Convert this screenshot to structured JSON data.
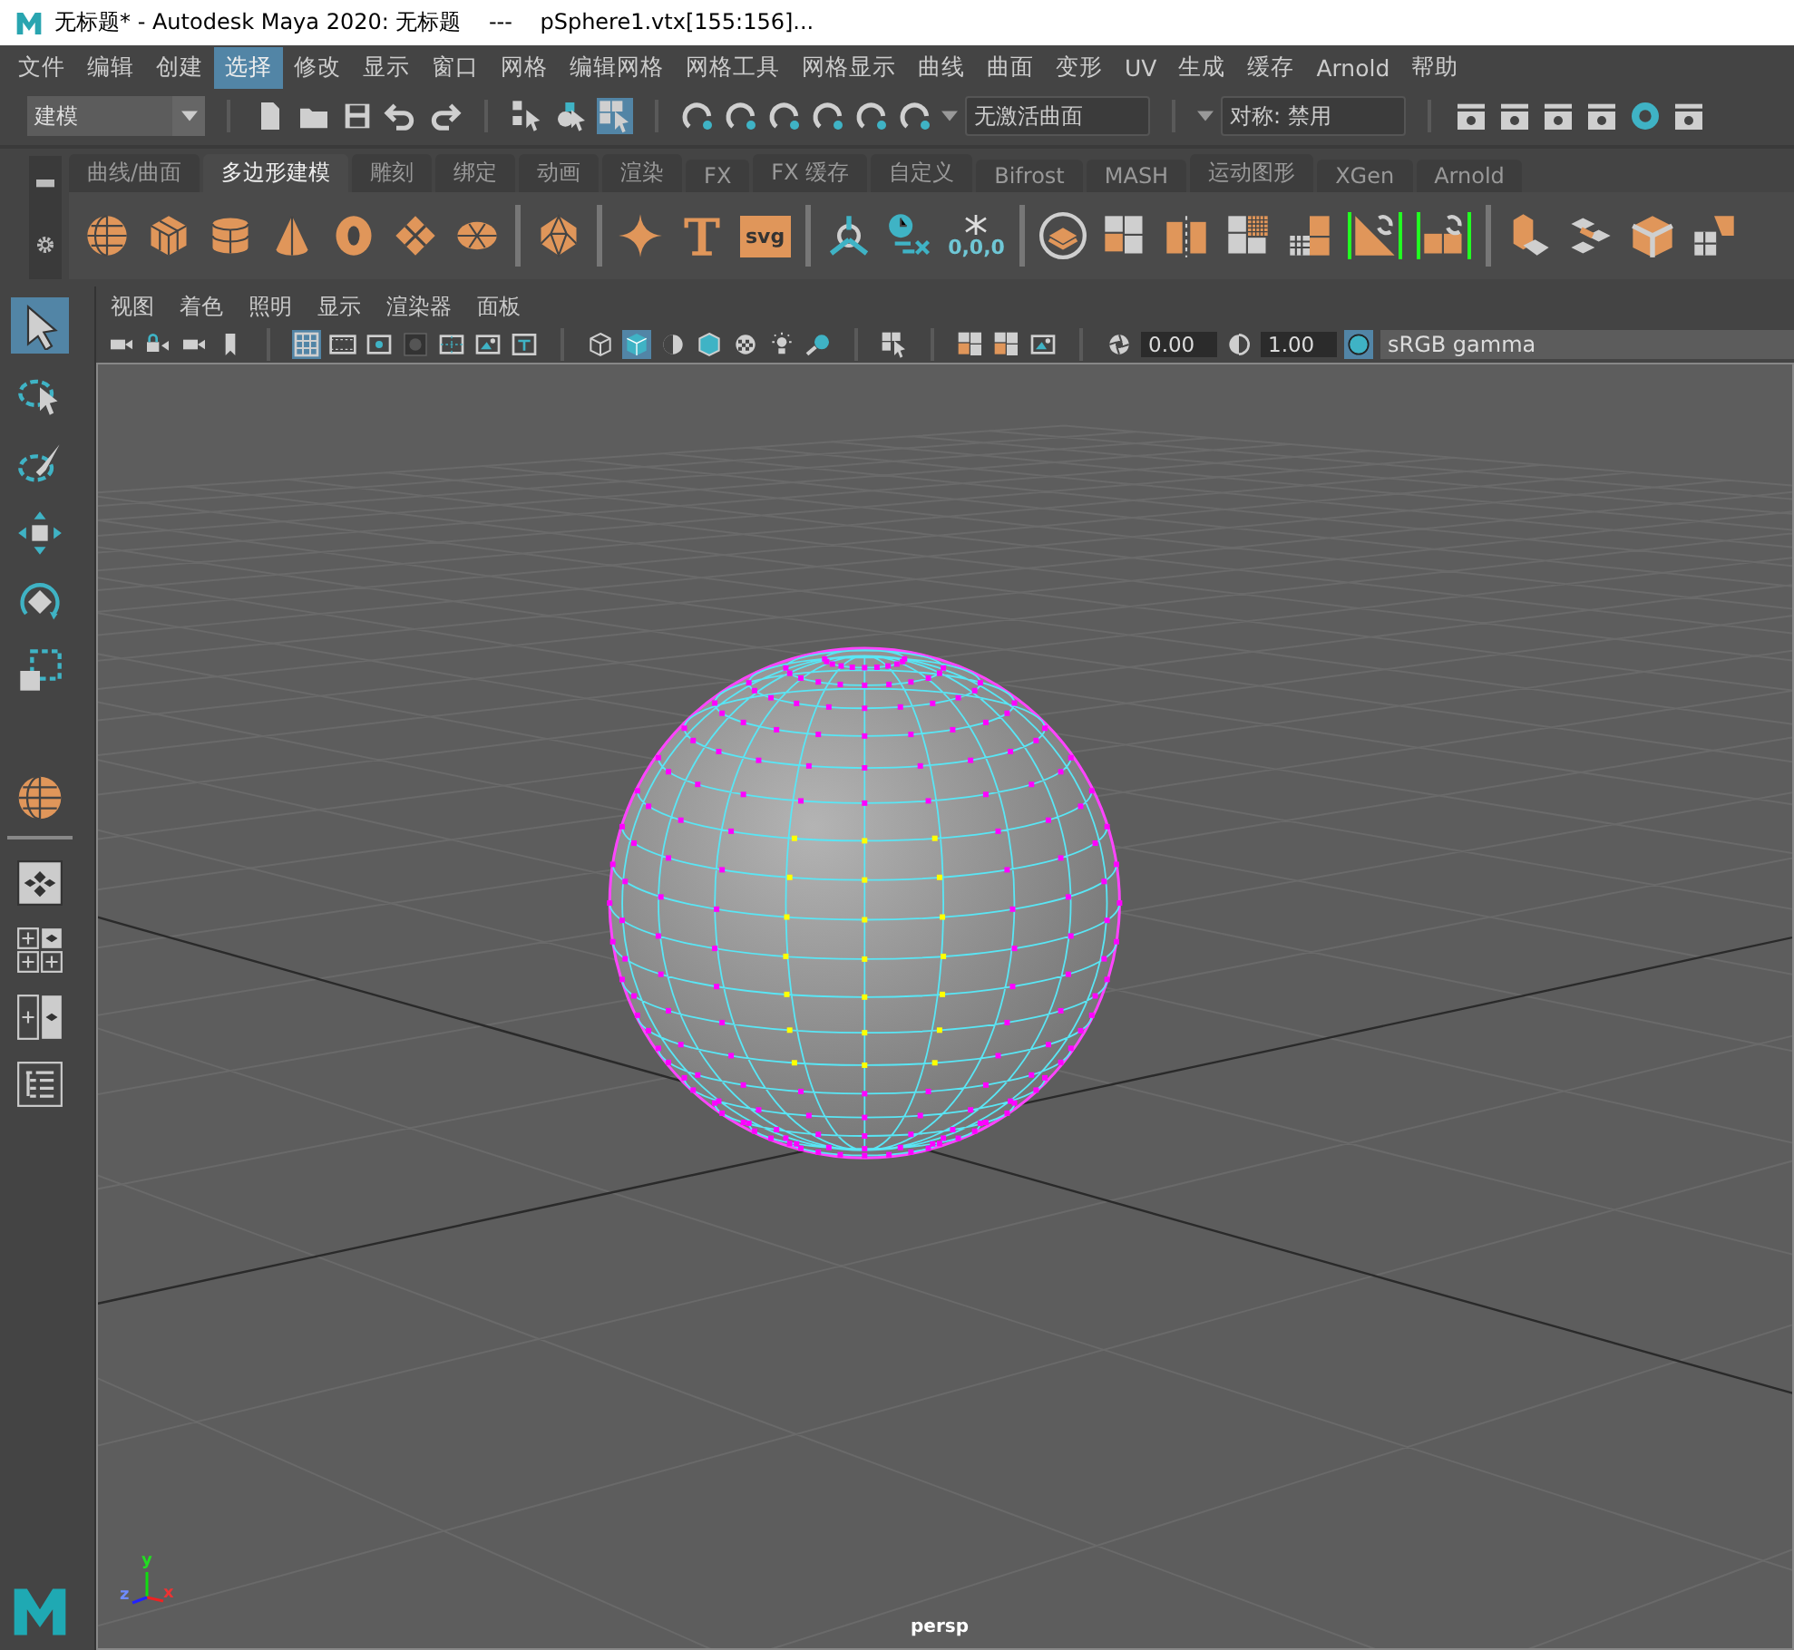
{
  "window": {
    "title": "无标题* - Autodesk Maya 2020: 无标题    ---    pSphere1.vtx[155:156]..."
  },
  "menu": [
    {
      "label": "文件",
      "selected": false
    },
    {
      "label": "编辑",
      "selected": false
    },
    {
      "label": "创建",
      "selected": false
    },
    {
      "label": "选择",
      "selected": true
    },
    {
      "label": "修改",
      "selected": false
    },
    {
      "label": "显示",
      "selected": false
    },
    {
      "label": "窗口",
      "selected": false
    },
    {
      "label": "网格",
      "selected": false
    },
    {
      "label": "编辑网格",
      "selected": false
    },
    {
      "label": "网格工具",
      "selected": false
    },
    {
      "label": "网格显示",
      "selected": false
    },
    {
      "label": "曲线",
      "selected": false
    },
    {
      "label": "曲面",
      "selected": false
    },
    {
      "label": "变形",
      "selected": false
    },
    {
      "label": "UV",
      "selected": false
    },
    {
      "label": "生成",
      "selected": false
    },
    {
      "label": "缓存",
      "selected": false
    },
    {
      "label": "Arnold",
      "selected": false
    },
    {
      "label": "帮助",
      "selected": false
    }
  ],
  "status_line": {
    "mode": "建模",
    "select_modes": [
      {
        "kind": "hierarchy",
        "selected": false
      },
      {
        "kind": "object",
        "selected": false
      },
      {
        "kind": "component",
        "selected": true
      }
    ],
    "curve_field": "无激活曲面",
    "symmetry": "对称: 禁用"
  },
  "shelf": {
    "tabs": [
      {
        "label": "曲线/曲面",
        "selected": false
      },
      {
        "label": "多边形建模",
        "selected": true
      },
      {
        "label": "雕刻",
        "selected": false
      },
      {
        "label": "绑定",
        "selected": false
      },
      {
        "label": "动画",
        "selected": false
      },
      {
        "label": "渲染",
        "selected": false
      },
      {
        "label": "FX",
        "selected": false
      },
      {
        "label": "FX 缓存",
        "selected": false
      },
      {
        "label": "自定义",
        "selected": false
      },
      {
        "label": "Bifrost",
        "selected": false
      },
      {
        "label": "MASH",
        "selected": false
      },
      {
        "label": "运动图形",
        "selected": false
      },
      {
        "label": "XGen",
        "selected": false
      },
      {
        "label": "Arnold",
        "selected": false
      }
    ],
    "svg_label": "svg",
    "freeze_label": "0,0,0"
  },
  "tools": [
    {
      "kind": "select",
      "selected": true
    },
    {
      "kind": "lasso",
      "selected": false
    },
    {
      "kind": "paint",
      "selected": false
    },
    {
      "kind": "move",
      "selected": false
    },
    {
      "kind": "rotate",
      "selected": false
    },
    {
      "kind": "scale",
      "selected": false
    }
  ],
  "viewport": {
    "menu": [
      "视图",
      "着色",
      "照明",
      "显示",
      "渲染器",
      "面板"
    ],
    "toggles": [
      {
        "kind": "grid",
        "selected": true
      },
      {
        "kind": "film",
        "selected": false
      },
      {
        "kind": "resolution",
        "selected": false
      },
      {
        "kind": "gate",
        "selected": false
      },
      {
        "kind": "guides",
        "selected": false
      },
      {
        "kind": "image",
        "selected": false
      },
      {
        "kind": "text",
        "selected": false
      },
      {
        "kind": "wire",
        "selected": false
      },
      {
        "kind": "shaded",
        "selected": true
      },
      {
        "kind": "half",
        "selected": false
      },
      {
        "kind": "wireshaded",
        "selected": false
      },
      {
        "kind": "checker",
        "selected": false
      },
      {
        "kind": "light",
        "selected": false
      },
      {
        "kind": "shadow",
        "selected": false
      }
    ],
    "exposure": "0.00",
    "gamma": "1.00",
    "color_space": "sRGB gamma",
    "camera": "persp",
    "axes": {
      "x": "x",
      "y": "y",
      "z": "z"
    }
  }
}
